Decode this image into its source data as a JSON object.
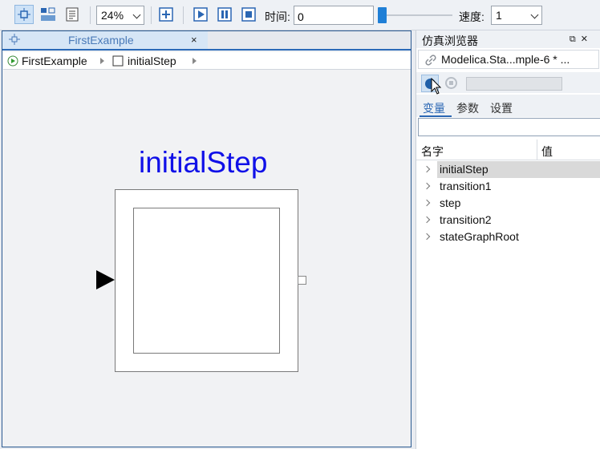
{
  "toolbar": {
    "zoom_value": "24%",
    "time_label": "时间:",
    "time_value": "0",
    "speed_label": "速度:",
    "speed_value": "1",
    "sim_progress": 0
  },
  "editor": {
    "tab_title": "FirstExample",
    "tab_close": "×",
    "breadcrumb": [
      "FirstExample",
      "initialStep"
    ]
  },
  "diagram": {
    "component_name": "initialStep",
    "title_color": "#1010e8"
  },
  "browser": {
    "title": "仿真浏览器",
    "model_name": "Modelica.Sta...mple-6 *",
    "model_more": "...",
    "tabs": [
      "变量",
      "参数",
      "设置"
    ],
    "columns": {
      "name": "名字",
      "value": "值"
    },
    "items": [
      "initialStep",
      "transition1",
      "step",
      "transition2",
      "stateGraphRoot"
    ],
    "accent": "#2a66b3"
  }
}
